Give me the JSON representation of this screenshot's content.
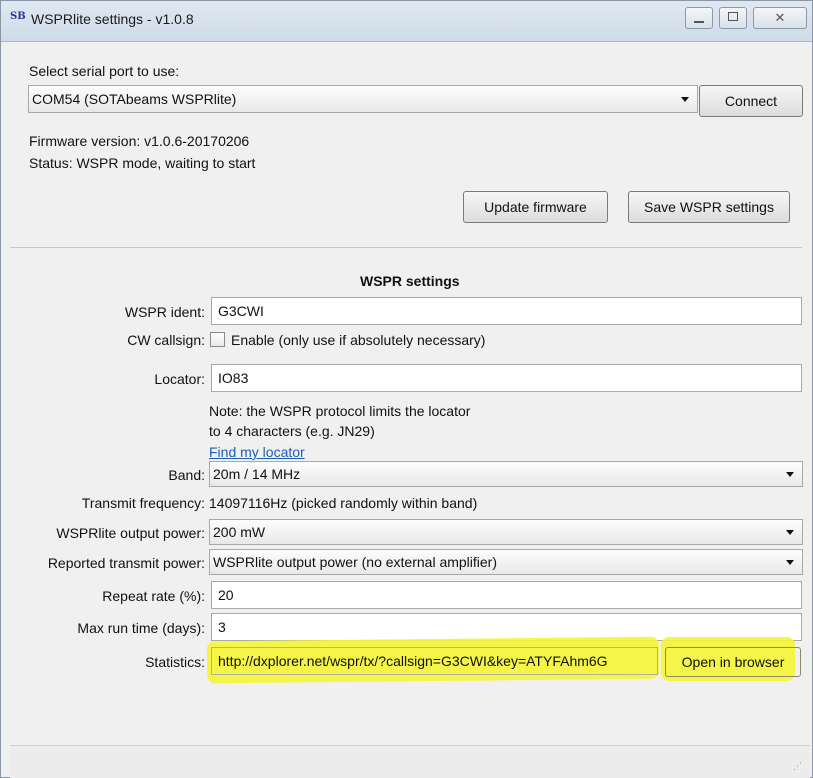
{
  "window": {
    "title": "WSPRlite settings - v1.0.8",
    "app_icon": "SB"
  },
  "connection": {
    "serial_label": "Select serial port to use:",
    "serial_port": "COM54 (SOTAbeams WSPRlite)",
    "connect_label": "Connect",
    "firmware_text": "Firmware version: v1.0.6-20170206",
    "status_text": "Status: WSPR mode, waiting to start",
    "update_firmware_label": "Update firmware",
    "save_settings_label": "Save WSPR settings"
  },
  "settings": {
    "heading": "WSPR settings",
    "ident_label": "WSPR ident:",
    "ident_value": "G3CWI",
    "cw_label": "CW callsign:",
    "cw_enable_text": "Enable (only use if absolutely necessary)",
    "locator_label": "Locator:",
    "locator_value": "IO83",
    "locator_note_1": "Note: the WSPR protocol limits the locator",
    "locator_note_2": "to 4 characters (e.g. JN29)",
    "find_locator_link": "Find my locator",
    "band_label": "Band:",
    "band_value": "20m / 14 MHz",
    "freq_label": "Transmit frequency:",
    "freq_value": "14097116Hz  (picked randomly within band)",
    "output_power_label": "WSPRlite output power:",
    "output_power_value": "200 mW",
    "reported_power_label": "Reported transmit power:",
    "reported_power_value": "WSPRlite output power (no external amplifier)",
    "repeat_label": "Repeat rate (%):",
    "repeat_value": "20",
    "runtime_label": "Max run time (days):",
    "runtime_value": "3",
    "stats_label": "Statistics:",
    "stats_url": "http://dxplorer.net/wspr/tx/?callsign=G3CWI&key=ATYFAhm6G",
    "open_browser_label": "Open in browser"
  },
  "colors": {
    "highlight": "#f4f53a",
    "link": "#1a5fb4"
  },
  "icons": {
    "minimize": "minimize-icon",
    "maximize": "maximize-icon",
    "close": "close-icon",
    "dropdown": "chevron-down-icon"
  }
}
